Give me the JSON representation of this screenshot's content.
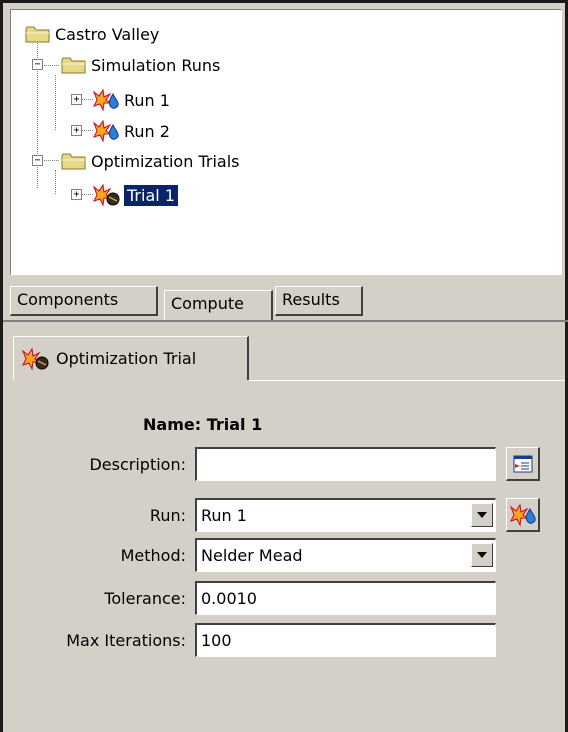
{
  "tree": {
    "root": "Castro Valley",
    "simulation_runs": "Simulation Runs",
    "runs": [
      "Run 1",
      "Run 2"
    ],
    "optimization_trials": "Optimization Trials",
    "trials": [
      "Trial 1"
    ]
  },
  "tabs": {
    "components": "Components",
    "compute": "Compute",
    "results": "Results"
  },
  "subtab": {
    "label": "Optimization Trial"
  },
  "form": {
    "name_label": "Name:",
    "name_value": "Trial 1",
    "description_label": "Description:",
    "description_value": "",
    "run_label": "Run:",
    "run_value": "Run 1",
    "method_label": "Method:",
    "method_value": "Nelder Mead",
    "tolerance_label": "Tolerance:",
    "tolerance_value": "0.0010",
    "max_iterations_label": "Max Iterations:",
    "max_iterations_value": "100"
  },
  "icons": {
    "folder": "folder-icon",
    "run": "simulation-run-icon",
    "trial": "optimization-trial-icon",
    "description_editor": "description-editor-icon",
    "run_shortcut": "simulation-run-icon"
  },
  "colors": {
    "selection": "#0a246a",
    "panel": "#d4d0c8"
  }
}
